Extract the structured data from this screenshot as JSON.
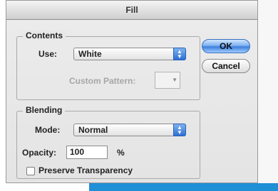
{
  "window": {
    "title": "Fill"
  },
  "contents": {
    "legend": "Contents",
    "use_label": "Use:",
    "use_value": "White",
    "custom_pattern_label": "Custom Pattern:"
  },
  "blending": {
    "legend": "Blending",
    "mode_label": "Mode:",
    "mode_value": "Normal",
    "opacity_label": "Opacity:",
    "opacity_value": "100",
    "opacity_unit": "%",
    "preserve_label": "Preserve Transparency",
    "preserve_checked": false
  },
  "buttons": {
    "ok": "OK",
    "cancel": "Cancel"
  },
  "colors": {
    "accent": "#3d7fdd",
    "strip": "#1f8fd6"
  },
  "icons": {
    "stepper": "up-down-arrows-icon",
    "swatch_arrow": "triangle-down-icon"
  }
}
